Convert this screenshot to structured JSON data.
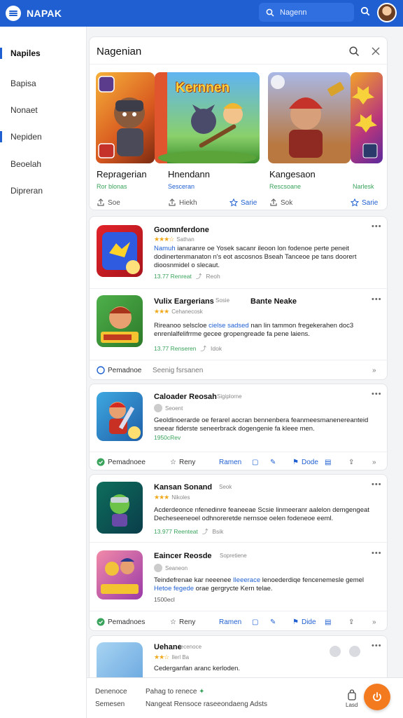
{
  "app": {
    "name": "NAPAK"
  },
  "search": {
    "placeholder": "Nagenn"
  },
  "sidebar": {
    "items": [
      {
        "label": "Napiles"
      },
      {
        "label": "Bapisa"
      },
      {
        "label": "Nonaet"
      },
      {
        "label": "Nepiden"
      },
      {
        "label": "Beoelah"
      },
      {
        "label": "Dipreran"
      }
    ]
  },
  "featured": {
    "title": "Nagenian",
    "tiles": [
      {
        "name": "Repragerian",
        "sub": "Ror blonas",
        "action": "Soe",
        "banner": ""
      },
      {
        "name": "Hnendann",
        "sub": "Sesceran",
        "action": "Hiekh",
        "action2": "Sarie",
        "banner": "Kernnen"
      },
      {
        "name": "Kangesaon",
        "sub": "Rescsoane",
        "sub2": "Narlesk",
        "action": "Sok",
        "action2": "Sarie"
      }
    ]
  },
  "group1": {
    "apps": [
      {
        "name": "Goomnferdone",
        "meta": "Sathan",
        "desc_a": "Namuh",
        "desc_b": " ianaranre oe Yosek sacanr ileoon lon fodenoe perte peneit dodinertenmanaton n's eot ascosnos Bseah Tanceoe pe tans doorert dioosnmidel o slecaut.",
        "foot_a": "13.77 Renreat",
        "foot_b": "Reoh"
      },
      {
        "name": "Vulix Eargerians",
        "meta": "Cehanecosk",
        "meta_b": "Sosie",
        "meta_c": "Bante Neake",
        "desc_a": "Rireanoo selscloe",
        "desc_hl": "cielse sadsed",
        "desc_b": " nan lin tammon fregekerahen doc3 enrenlalfelifrrme gecee gropengreade fa pene laiens.",
        "foot_a": "13.77 Renseren",
        "foot_b": "Idok"
      }
    ],
    "footer": {
      "label": "Pemadnoe",
      "sub": "Seenig fsrsanen"
    }
  },
  "group2": {
    "apps": [
      {
        "name": "Caloader Reosah",
        "meta": "Sigiplorne",
        "meta_b": "Seoent",
        "desc_a": "Geoldinoerarde oe ferarel aocran bennenbera feanmeesmanenereanteid sneear fiderste seneerbrack dogengenie fa kleee men.",
        "foot_a": "1950cRev"
      }
    ],
    "footer": {
      "label": "Pemadnoee",
      "rany": "Reny",
      "ramen": "Ramen",
      "dode": "Dode"
    }
  },
  "group3": {
    "apps": [
      {
        "name": "Kansan Sonand",
        "meta": "Seok",
        "meta_b": "Nikoles",
        "desc_a": "Acderdeonce nfenedinre feaneeae Scsie linmeeranr aalelon demgengeat Decheseeneoel odhnoreretde nernsoe oelen fodeneoe eeml.",
        "foot_a": "13.977 Reenteat",
        "foot_b": "Bsik"
      },
      {
        "name": "Eaincer Reosde",
        "meta": "Sopretiene",
        "meta_b": "Seaneon",
        "desc_a": "Teindefrenae kar neeenee",
        "desc_hl": "Ileeerace",
        "desc_b": " lenoederdiqe fencenemesle gemel",
        "desc_hl2": "Hetoe fegede",
        "desc_c": " orae gergrycte Kern telae.",
        "foot_a": "1500ecl"
      }
    ],
    "footer": {
      "label": "Pemadnoes",
      "rany": "Reny",
      "ramen": "Ramen",
      "dode": "Dide"
    }
  },
  "group4": {
    "apps": [
      {
        "name": "Uehane",
        "name_b": "lecenoce",
        "meta": "Ilerl Ba",
        "desc_a": "Cederganfan aranc kerloden."
      }
    ]
  },
  "bottom": {
    "left_a": "Denenoce",
    "left_b": "Semesen",
    "mid_a": "Pahag to renece",
    "mid_b": "Nangeat Rensoce raseeondaeng Adsts",
    "bag_label": "Lasd"
  },
  "colors": {
    "brand": "#1f5fd1",
    "accent": "#f47a20",
    "green": "#3aa35c",
    "star": "#f0a81b"
  }
}
